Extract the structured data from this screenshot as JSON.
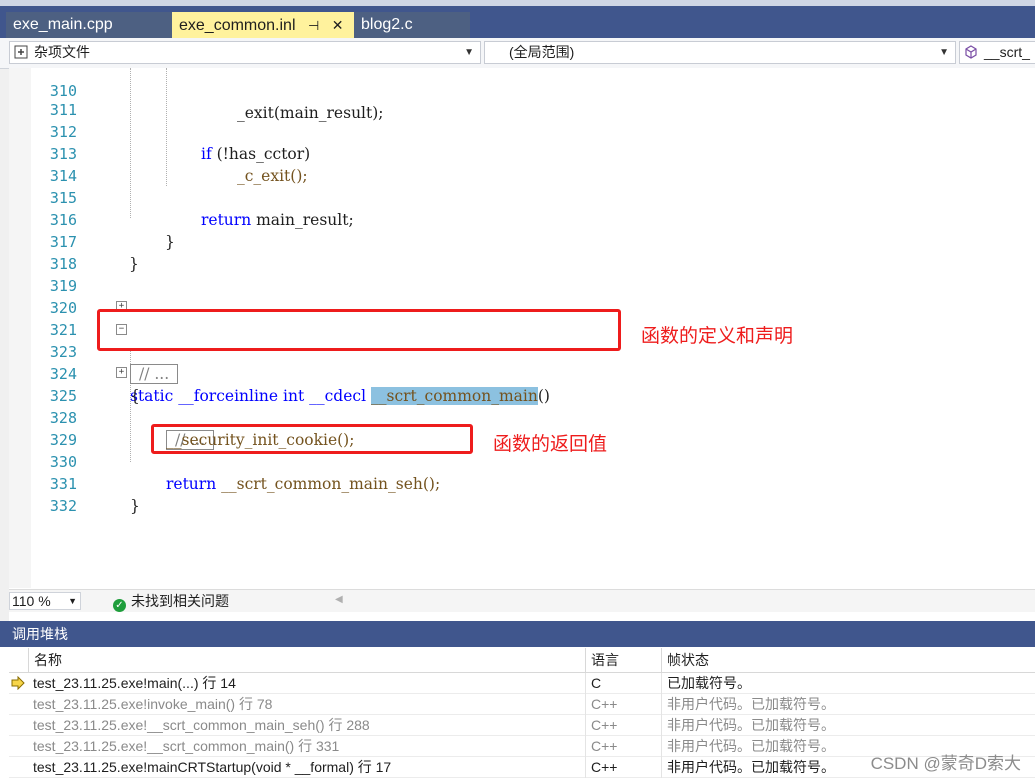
{
  "tabs": [
    {
      "label": "exe_main.cpp",
      "active": false
    },
    {
      "label": "exe_common.inl",
      "active": true,
      "pin": "⊣",
      "close": "✕"
    },
    {
      "label": "blog2.c",
      "active": false
    }
  ],
  "navbar": {
    "project": "杂项文件",
    "scope": "(全局范围)",
    "member": "__scrt_"
  },
  "code_lines": [
    {
      "num": "310",
      "text": "_exit(main_result);",
      "kind": "partial"
    },
    {
      "num": "311",
      "text": ""
    },
    {
      "num": "312",
      "text": "if (!has_cctor)"
    },
    {
      "num": "313",
      "text": "_c_exit();"
    },
    {
      "num": "314",
      "text": ""
    },
    {
      "num": "315",
      "text": "return main_result;"
    },
    {
      "num": "316",
      "text": "}"
    },
    {
      "num": "317",
      "text": "}"
    },
    {
      "num": "318",
      "text": ""
    },
    {
      "num": "319",
      "text": ""
    },
    {
      "num": "320",
      "text": ""
    },
    {
      "num": "321",
      "text": "// ..."
    },
    {
      "num": "323",
      "text": "static __forceinline int __cdecl __scrt_common_main()"
    },
    {
      "num": "324",
      "text": "{"
    },
    {
      "num": "325",
      "text": "// ..."
    },
    {
      "num": "328",
      "text": "__security_init_cookie();"
    },
    {
      "num": "329",
      "text": ""
    },
    {
      "num": "330",
      "text": "return __scrt_common_main_seh();"
    },
    {
      "num": "331",
      "text": "}"
    },
    {
      "num": "332",
      "text": ""
    }
  ],
  "code_tokens": {
    "if_kw": "if",
    "has_cctor": " (!has_cctor)",
    "c_exit": "_c_exit();",
    "return_kw": "return",
    "main_result": " main_result;",
    "static_kw": "static",
    "forceinline_kw": "__forceinline",
    "int_kw": "int",
    "cdecl_kw": "__cdecl",
    "func_name": "__scrt_common_main",
    "parens": "()",
    "security": "__security_init_cookie();",
    "seh_call": " __scrt_common_main_seh();",
    "collapsed": "// ...",
    "exit_partial": "_exit(main_result);",
    "brace_close": "}",
    "brace_open": "{"
  },
  "annotations": {
    "definition": "函数的定义和声明",
    "return_value": "函数的返回值"
  },
  "status": {
    "zoom": "110 %",
    "message": "未找到相关问题"
  },
  "callstack": {
    "title": "调用堆栈",
    "columns": [
      "名称",
      "语言",
      "帧状态"
    ],
    "rows": [
      {
        "name": "test_23.11.25.exe!main(...) 行 14",
        "lang": "C",
        "state": "已加载符号。",
        "current": true,
        "gray": false
      },
      {
        "name": "test_23.11.25.exe!invoke_main() 行 78",
        "lang": "C++",
        "state": "非用户代码。已加载符号。",
        "current": false,
        "gray": true
      },
      {
        "name": "test_23.11.25.exe!__scrt_common_main_seh() 行 288",
        "lang": "C++",
        "state": "非用户代码。已加载符号。",
        "current": false,
        "gray": true
      },
      {
        "name": "test_23.11.25.exe!__scrt_common_main() 行 331",
        "lang": "C++",
        "state": "非用户代码。已加载符号。",
        "current": false,
        "gray": true
      },
      {
        "name": "test_23.11.25.exe!mainCRTStartup(void * __formal) 行 17",
        "lang": "C++",
        "state": "非用户代码。已加载符号。",
        "current": false,
        "gray": false
      }
    ]
  },
  "watermark": "CSDN @蒙奇D索大"
}
